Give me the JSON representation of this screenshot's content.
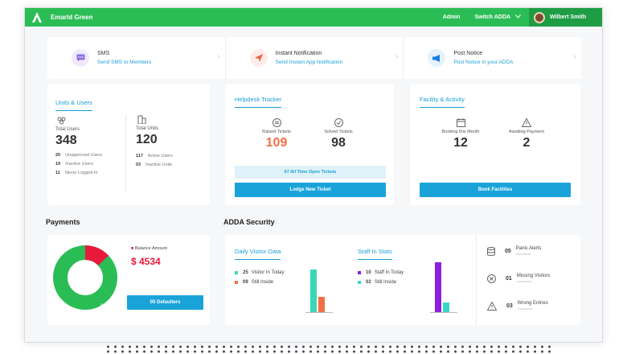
{
  "header": {
    "brand": "Emarld Green",
    "admin": "Admin",
    "switch": "Switch ADDA",
    "user": "Wilbert Smith"
  },
  "quick_actions": [
    {
      "title": "SMS",
      "subtitle": "Send SMS to Members",
      "icon": "sms-icon",
      "color": "#8e6ee6",
      "bg": "#efeafc"
    },
    {
      "title": "Instant Notification",
      "subtitle": "Send Instant App Notification",
      "icon": "send-icon",
      "color": "#f0603a",
      "bg": "#fdece7"
    },
    {
      "title": "Post Notice",
      "subtitle": "Post Notice in your ADDA",
      "icon": "megaphone-icon",
      "color": "#1e7fe0",
      "bg": "#e5f1fc"
    }
  ],
  "units_users": {
    "title": "Units & Users",
    "total_users_label": "Total Users",
    "total_users": "348",
    "total_units_label": "Total Units",
    "total_units": "120",
    "user_rows": [
      {
        "n": "20",
        "t": "Unapproved Users"
      },
      {
        "n": "19",
        "t": "Inactive Users"
      },
      {
        "n": "11",
        "t": "Never Logged In"
      }
    ],
    "unit_rows": [
      {
        "n": "117",
        "t": "Active Users"
      },
      {
        "n": "03",
        "t": "Inactive Units"
      }
    ]
  },
  "helpdesk": {
    "title": "Helpdesk Tracker",
    "raised_label": "Raised Tickets",
    "raised": "109",
    "solved_label": "Solved Tickets",
    "solved": "98",
    "open_tickets": "67 All Time Open Tickets",
    "lodge_button": "Lodge New Ticket"
  },
  "facility": {
    "title": "Facility & Activity",
    "booking_label": "Booking this Month",
    "booking": "12",
    "awaiting_label": "Awaiting Payment",
    "awaiting": "2",
    "book_button": "Book Facilities"
  },
  "payments": {
    "title": "Payments",
    "balance_label": "Balance Amount",
    "balance": "$ 4534",
    "defaulters_button": "05 Defaulters",
    "pie_red_label": "13%",
    "pie_green_label": "87%",
    "pie_red_fraction": 0.13
  },
  "security": {
    "title": "ADDA Security",
    "visitor": {
      "title": "Daily Visitor Data",
      "items": [
        {
          "n": "25",
          "t": "Visitor In Today",
          "color": "#3ad6b5"
        },
        {
          "n": "09",
          "t": "Still Inside",
          "color": "#f36f43"
        }
      ]
    },
    "staff": {
      "title": "Staff In Stats",
      "items": [
        {
          "n": "10",
          "t": "Staff In Today",
          "color": "#8c1fe0"
        },
        {
          "n": "02",
          "t": "Still Inside",
          "color": "#3ad6c9"
        }
      ]
    },
    "alerts": [
      {
        "n": "05",
        "t": "Panic Alerts",
        "sub": "THIS MONTH",
        "icon": "database-icon"
      },
      {
        "n": "01",
        "t": "Missing Visitors",
        "sub": "THIS MONTH",
        "icon": "cancel-circle-icon"
      },
      {
        "n": "03",
        "t": "Wrong Entries",
        "sub": "THIS MONTH",
        "icon": "warning-icon"
      }
    ]
  }
}
